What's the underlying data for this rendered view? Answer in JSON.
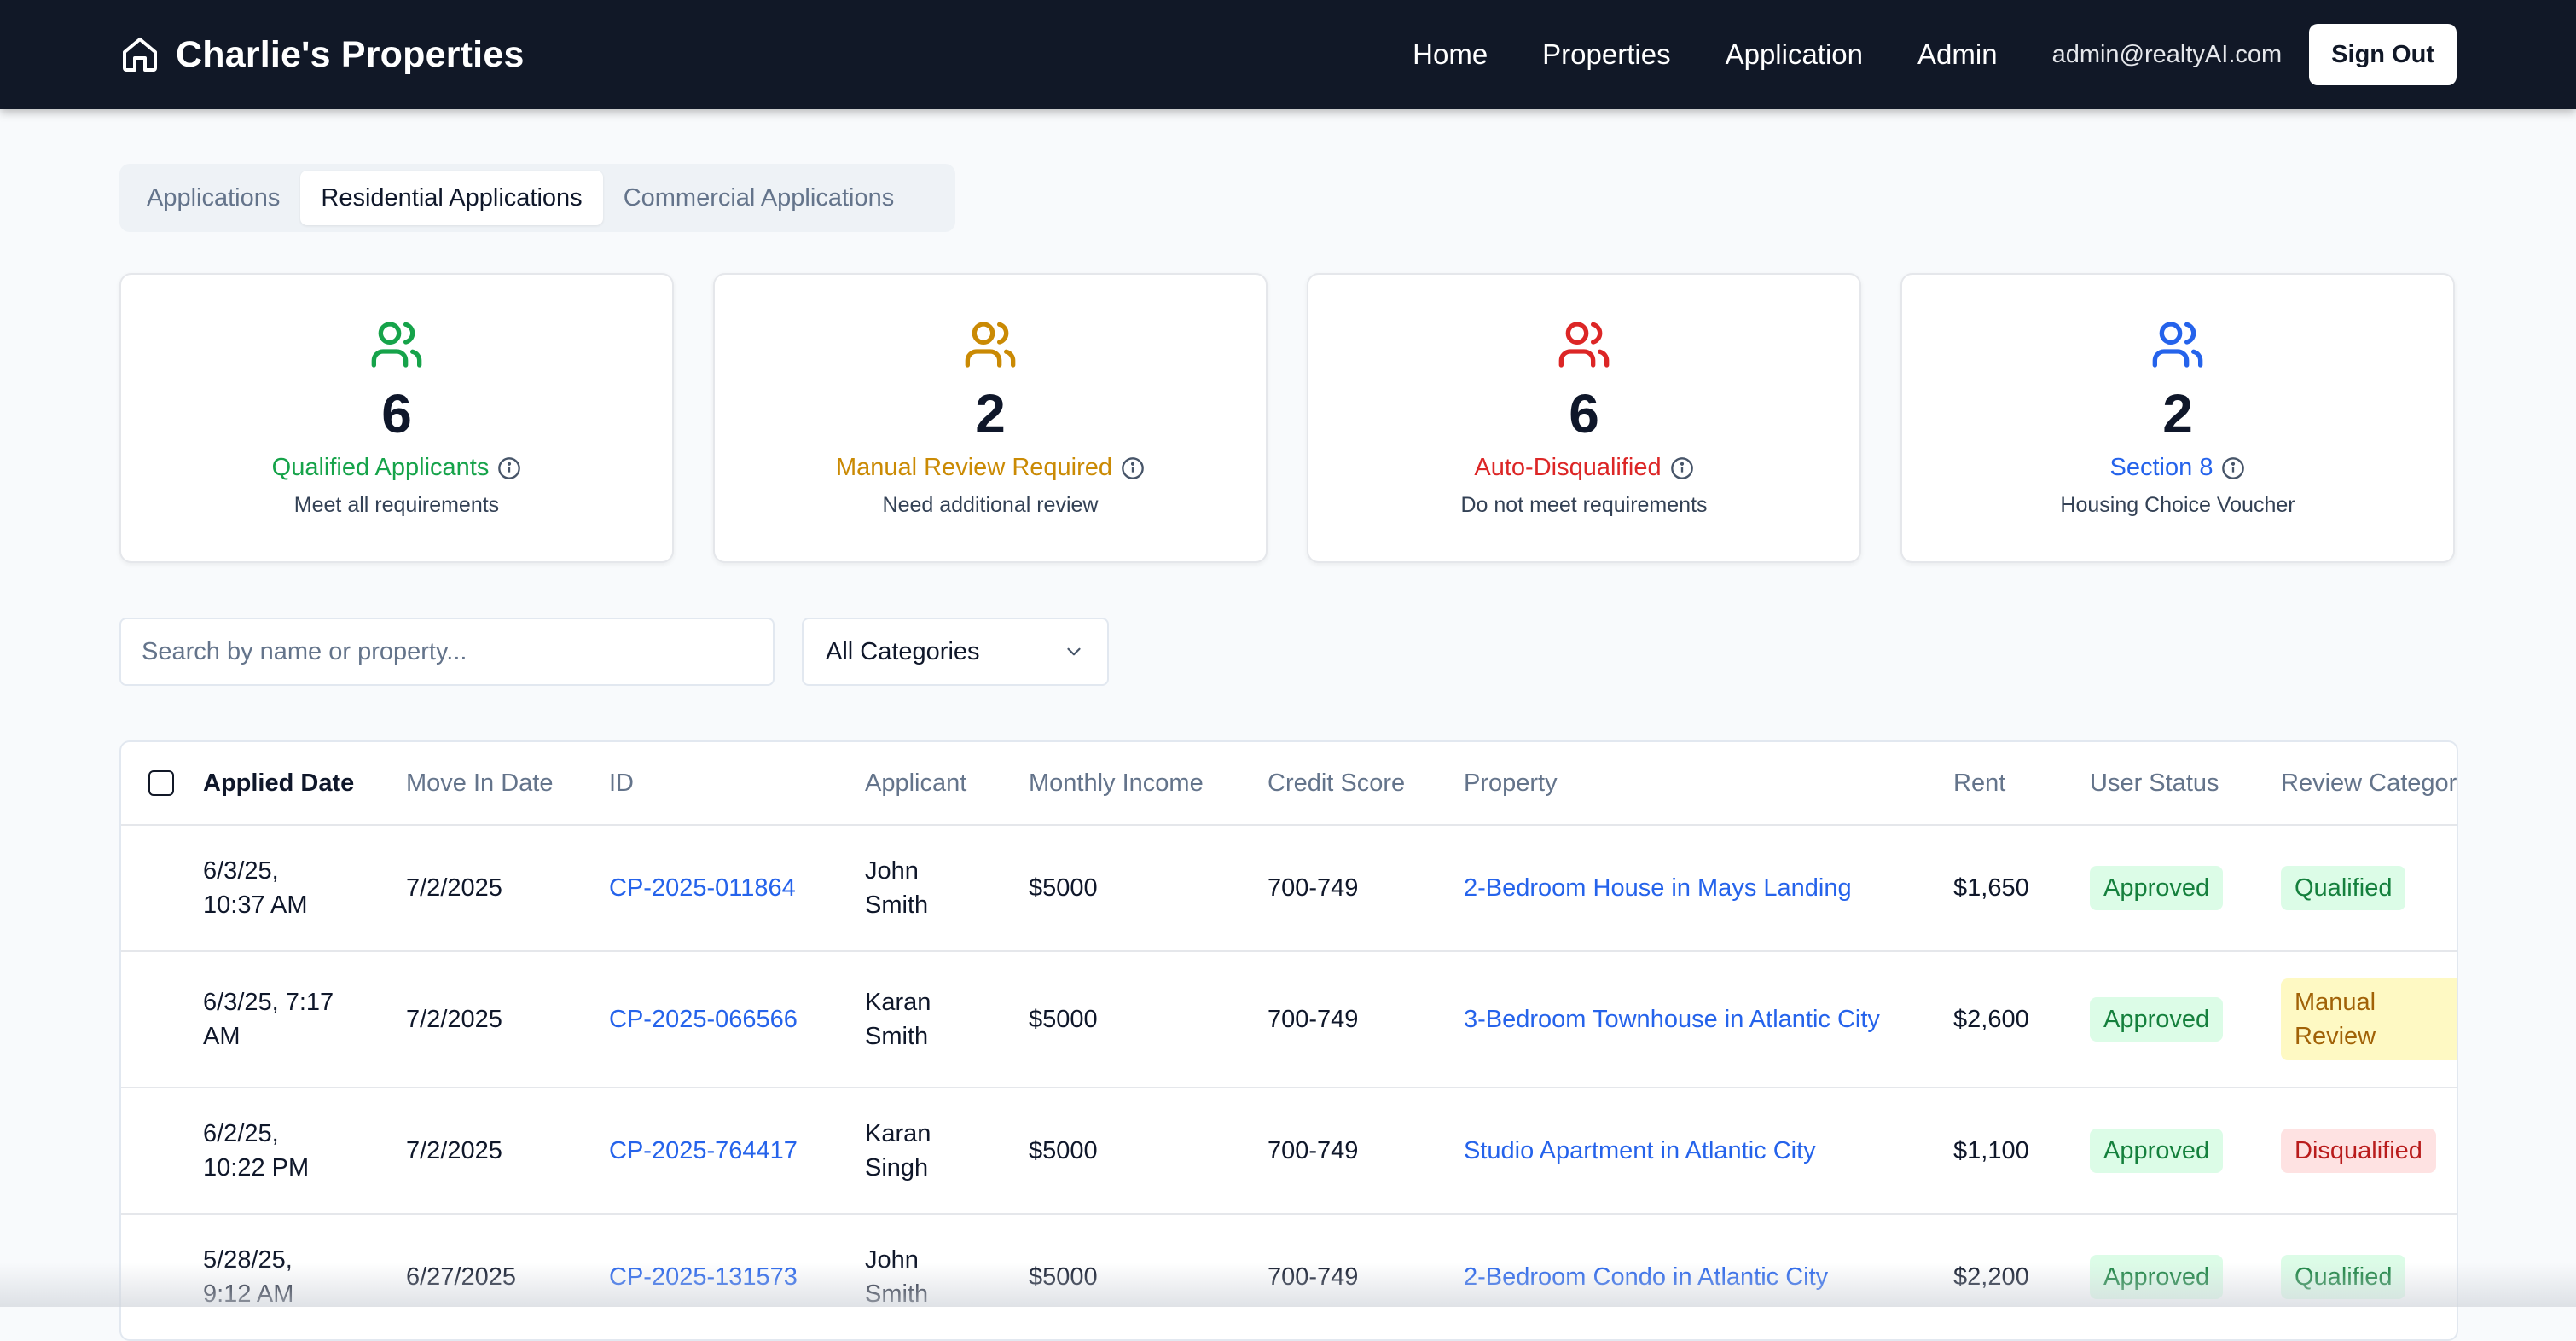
{
  "header": {
    "brand": "Charlie's Properties",
    "nav": [
      "Home",
      "Properties",
      "Application",
      "Admin"
    ],
    "email": "admin@realtyAI.com",
    "sign_out": "Sign Out"
  },
  "tabs": [
    "Applications",
    "Residential Applications",
    "Commercial Applications"
  ],
  "active_tab": "Residential Applications",
  "stats": [
    {
      "count": "6",
      "label": "Qualified Applicants",
      "sub": "Meet all requirements",
      "color": "#16a34a"
    },
    {
      "count": "2",
      "label": "Manual Review Required",
      "sub": "Need additional review",
      "color": "#ca8a04"
    },
    {
      "count": "6",
      "label": "Auto-Disqualified",
      "sub": "Do not meet requirements",
      "color": "#dc2626"
    },
    {
      "count": "2",
      "label": "Section 8",
      "sub": "Housing Choice Voucher",
      "color": "#2563eb"
    }
  ],
  "search": {
    "placeholder": "Search by name or property..."
  },
  "filter": {
    "selected": "All Categories"
  },
  "table": {
    "columns": [
      "Applied Date",
      "Move In Date",
      "ID",
      "Applicant",
      "Monthly Income",
      "Credit Score",
      "Property",
      "Rent",
      "User Status",
      "Review Category"
    ],
    "rows": [
      {
        "applied": "6/3/25,\n10:37 AM",
        "move_in": "7/2/2025",
        "id": "CP-2025-011864",
        "applicant": "John\nSmith",
        "income": "$5000",
        "credit": "700-749",
        "property": "2-Bedroom House in Mays Landing",
        "rent": "$1,650",
        "status": "Approved",
        "category": "Qualified"
      },
      {
        "applied": "6/3/25, 7:17\nAM",
        "move_in": "7/2/2025",
        "id": "CP-2025-066566",
        "applicant": "Karan\nSmith",
        "income": "$5000",
        "credit": "700-749",
        "property": "3-Bedroom Townhouse in Atlantic City",
        "rent": "$2,600",
        "status": "Approved",
        "category": "Manual\nReview"
      },
      {
        "applied": "6/2/25,\n10:22 PM",
        "move_in": "7/2/2025",
        "id": "CP-2025-764417",
        "applicant": "Karan\nSingh",
        "income": "$5000",
        "credit": "700-749",
        "property": "Studio Apartment in Atlantic City",
        "rent": "$1,100",
        "status": "Approved",
        "category": "Disqualified"
      },
      {
        "applied": "5/28/25,\n9:12 AM",
        "move_in": "6/27/2025",
        "id": "CP-2025-131573",
        "applicant": "John\nSmith",
        "income": "$5000",
        "credit": "700-749",
        "property": "2-Bedroom Condo in Atlantic City",
        "rent": "$2,200",
        "status": "Approved",
        "category": "Qualified"
      }
    ]
  }
}
